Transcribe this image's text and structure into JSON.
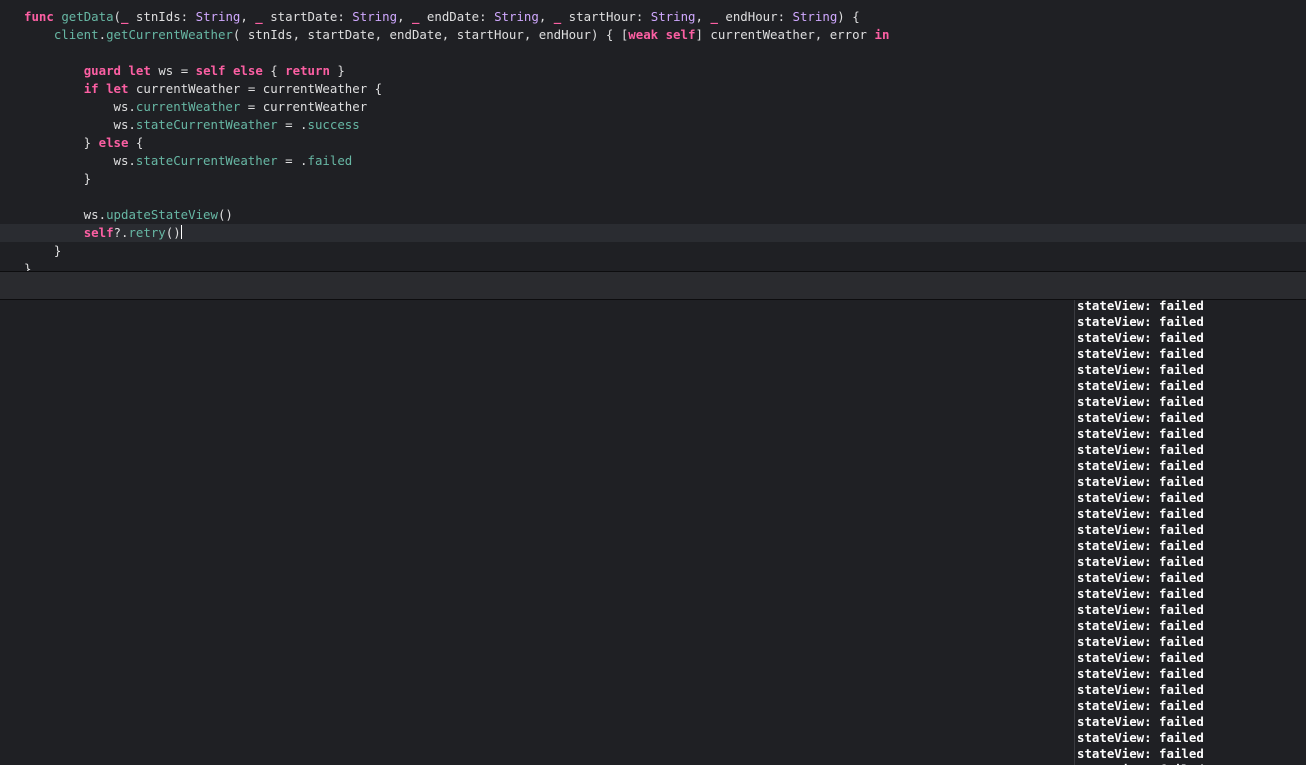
{
  "editor": {
    "language": "swift",
    "current_line_index": 12,
    "lines": [
      [
        {
          "t": "func",
          "k": "keyword"
        },
        {
          "t": " "
        },
        {
          "t": "getData",
          "k": "func"
        },
        {
          "t": "("
        },
        {
          "t": "_",
          "k": "keyword"
        },
        {
          "t": " stnIds: "
        },
        {
          "t": "String",
          "k": "type"
        },
        {
          "t": ", "
        },
        {
          "t": "_",
          "k": "keyword"
        },
        {
          "t": " startDate: "
        },
        {
          "t": "String",
          "k": "type"
        },
        {
          "t": ", "
        },
        {
          "t": "_",
          "k": "keyword"
        },
        {
          "t": " endDate: "
        },
        {
          "t": "String",
          "k": "type"
        },
        {
          "t": ", "
        },
        {
          "t": "_",
          "k": "keyword"
        },
        {
          "t": " startHour: "
        },
        {
          "t": "String",
          "k": "type"
        },
        {
          "t": ", "
        },
        {
          "t": "_",
          "k": "keyword"
        },
        {
          "t": " endHour: "
        },
        {
          "t": "String",
          "k": "type"
        },
        {
          "t": ") {"
        }
      ],
      [
        {
          "t": "    "
        },
        {
          "t": "client",
          "k": "prop"
        },
        {
          "t": "."
        },
        {
          "t": "getCurrentWeather",
          "k": "func"
        },
        {
          "t": "( stnIds, startDate, endDate, startHour, endHour) { ["
        },
        {
          "t": "weak",
          "k": "keyword"
        },
        {
          "t": " "
        },
        {
          "t": "self",
          "k": "keyword"
        },
        {
          "t": "] currentWeather, error "
        },
        {
          "t": "in",
          "k": "keyword"
        }
      ],
      [
        {
          "t": ""
        }
      ],
      [
        {
          "t": "        "
        },
        {
          "t": "guard",
          "k": "keyword"
        },
        {
          "t": " "
        },
        {
          "t": "let",
          "k": "keyword"
        },
        {
          "t": " ws = "
        },
        {
          "t": "self",
          "k": "keyword"
        },
        {
          "t": " "
        },
        {
          "t": "else",
          "k": "keyword"
        },
        {
          "t": " { "
        },
        {
          "t": "return",
          "k": "keyword"
        },
        {
          "t": " }"
        }
      ],
      [
        {
          "t": "        "
        },
        {
          "t": "if",
          "k": "keyword"
        },
        {
          "t": " "
        },
        {
          "t": "let",
          "k": "keyword"
        },
        {
          "t": " currentWeather = currentWeather {"
        }
      ],
      [
        {
          "t": "            ws."
        },
        {
          "t": "currentWeather",
          "k": "prop"
        },
        {
          "t": " = currentWeather"
        }
      ],
      [
        {
          "t": "            ws."
        },
        {
          "t": "stateCurrentWeather",
          "k": "prop"
        },
        {
          "t": " = ."
        },
        {
          "t": "success",
          "k": "prop"
        }
      ],
      [
        {
          "t": "        } "
        },
        {
          "t": "else",
          "k": "keyword"
        },
        {
          "t": " {"
        }
      ],
      [
        {
          "t": "            ws."
        },
        {
          "t": "stateCurrentWeather",
          "k": "prop"
        },
        {
          "t": " = ."
        },
        {
          "t": "failed",
          "k": "prop"
        }
      ],
      [
        {
          "t": "        }"
        }
      ],
      [
        {
          "t": ""
        }
      ],
      [
        {
          "t": "        ws."
        },
        {
          "t": "updateStateView",
          "k": "func"
        },
        {
          "t": "()"
        }
      ],
      [
        {
          "t": "        "
        },
        {
          "t": "self",
          "k": "keyword"
        },
        {
          "t": "?."
        },
        {
          "t": "retry",
          "k": "func"
        },
        {
          "t": "()"
        },
        {
          "t": "",
          "caret": true
        }
      ],
      [
        {
          "t": "    }"
        }
      ],
      [
        {
          "t": "}"
        }
      ]
    ]
  },
  "console": {
    "lines": [
      "stateView: failed",
      "stateView: failed",
      "stateView: failed",
      "stateView: failed",
      "stateView: failed",
      "stateView: failed",
      "stateView: failed",
      "stateView: failed",
      "stateView: failed",
      "stateView: failed",
      "stateView: failed",
      "stateView: failed",
      "stateView: failed",
      "stateView: failed",
      "stateView: failed",
      "stateView: failed",
      "stateView: failed",
      "stateView: failed",
      "stateView: failed",
      "stateView: failed",
      "stateView: failed",
      "stateView: failed",
      "stateView: failed",
      "stateView: failed",
      "stateView: failed",
      "stateView: failed",
      "stateView: failed",
      "stateView: failed",
      "stateView: failed",
      "stateView: failed"
    ]
  },
  "colors": {
    "background": "#1f2024",
    "keyword": "#fc5fa3",
    "type": "#d0a8ff",
    "function": "#67b7a4",
    "plain_text": "#dfdfe0",
    "current_line_highlight": "#2a2c31",
    "console_text": "#ffffff"
  }
}
